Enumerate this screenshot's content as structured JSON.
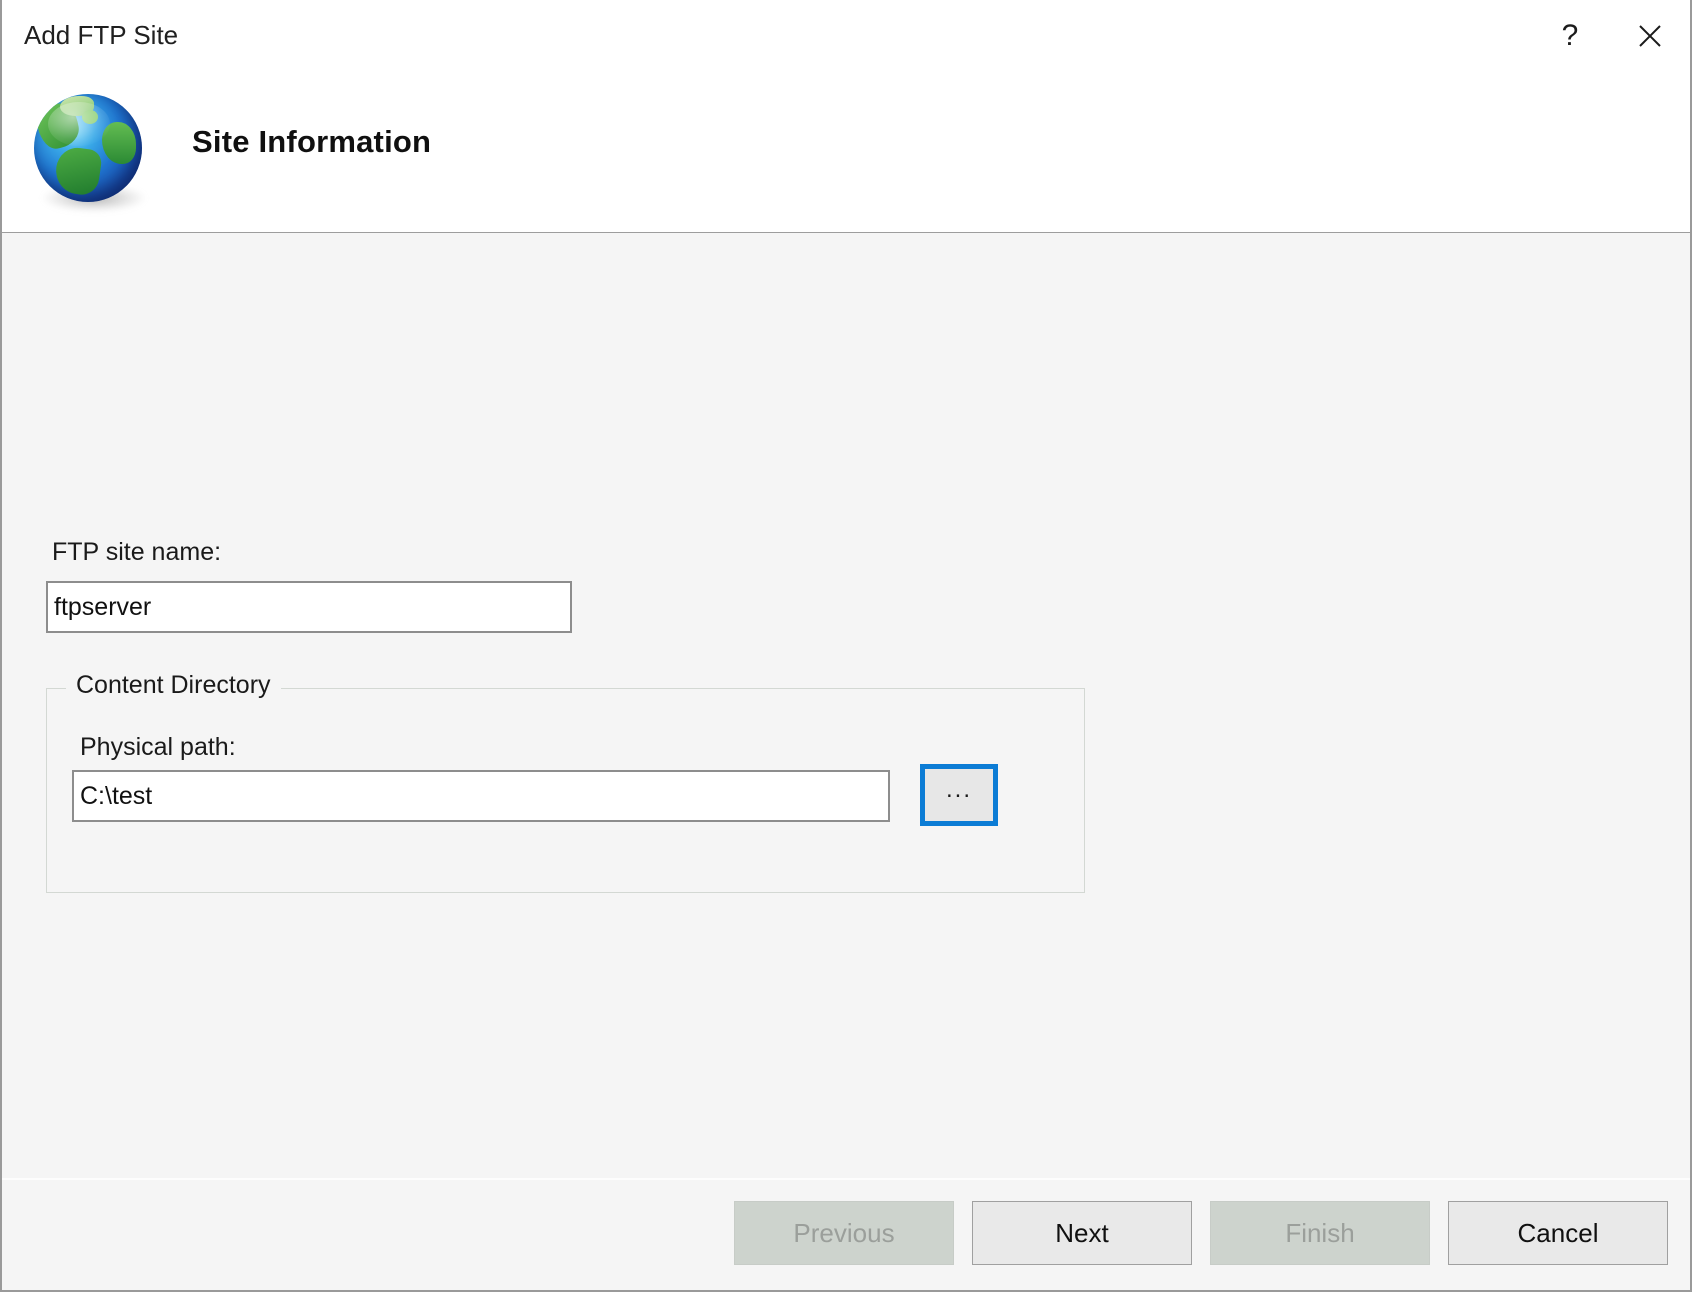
{
  "window": {
    "title": "Add FTP Site",
    "help_label": "?",
    "close_label": "✕",
    "help_icon": "question-mark-icon",
    "close_icon": "close-x-icon"
  },
  "header": {
    "icon": "globe-icon",
    "title": "Site Information"
  },
  "form": {
    "site_name": {
      "label": "FTP site name:",
      "value": "ftpserver",
      "placeholder": ""
    },
    "content_directory": {
      "legend": "Content Directory",
      "physical_path": {
        "label": "Physical path:",
        "value": "C:\\test",
        "placeholder": ""
      },
      "browse_label": "...",
      "browse_icon": "ellipsis-icon"
    }
  },
  "footer": {
    "buttons": [
      {
        "label": "Previous",
        "enabled": false
      },
      {
        "label": "Next",
        "enabled": true
      },
      {
        "label": "Finish",
        "enabled": false
      },
      {
        "label": "Cancel",
        "enabled": true
      }
    ]
  },
  "colors": {
    "focus_blue": "#0c7cd5",
    "dialog_bg": "#f5f5f5",
    "header_bg": "#ffffff"
  }
}
